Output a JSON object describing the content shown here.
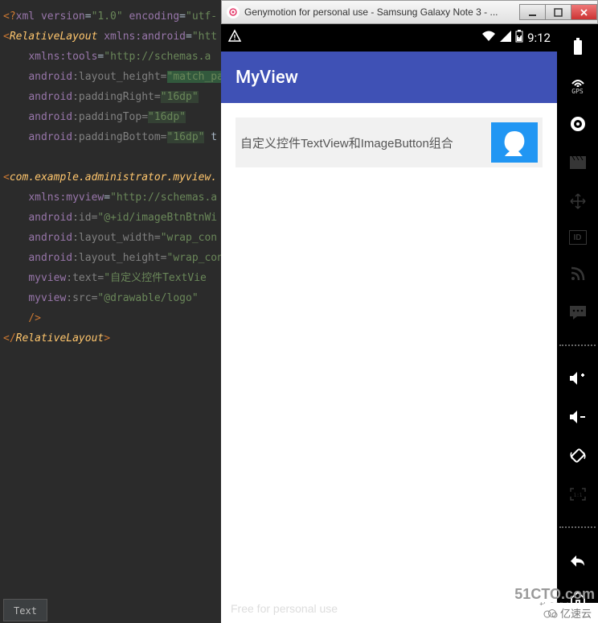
{
  "code": {
    "l1a": "<?",
    "l1b": "xml version",
    "l1c": "=",
    "l1d": "\"1.0\"",
    "l1e": " encoding",
    "l1f": "=",
    "l1g": "\"utf-",
    "l2a": "<",
    "l2b": "RelativeLayout ",
    "l2c": "xmlns:",
    "l2d": "android",
    "l2e": "=",
    "l2f": "\"htt",
    "l3a": "    ",
    "l3b": "xmlns:",
    "l3c": "tools",
    "l3d": "=",
    "l3e": "\"http://schemas.a",
    "l4a": "    ",
    "l4b": "android",
    "l4c": ":layout_height=",
    "l4d": "\"match_pa",
    "l5a": "    ",
    "l5b": "android",
    "l5c": ":paddingRight=",
    "l5d": "\"16dp\"",
    "l6a": "    ",
    "l6b": "android",
    "l6c": ":paddingTop=",
    "l6d": "\"16dp\"",
    "l7a": "    ",
    "l7b": "android",
    "l7c": ":paddingBottom=",
    "l7d": "\"16dp\"",
    "l7e": " t",
    "l8": "",
    "l9a": "<",
    "l9b": "com.example.administrator.myview.",
    "l10a": "    ",
    "l10b": "xmlns:",
    "l10c": "myview",
    "l10d": "=",
    "l10e": "\"http://schemas.a",
    "l11a": "    ",
    "l11b": "android",
    "l11c": ":id=",
    "l11d": "\"@+id/imageBtnBtnWi",
    "l12a": "    ",
    "l12b": "android",
    "l12c": ":layout_width=",
    "l12d": "\"wrap_con",
    "l13a": "    ",
    "l13b": "android",
    "l13c": ":layout_height=",
    "l13d": "\"wrap_con",
    "l14a": "    ",
    "l14b": "myview",
    "l14c": ":text=",
    "l14d": "\"自定义控件TextVie",
    "l15a": "    ",
    "l15b": "myview",
    "l15c": ":src=",
    "l15d": "\"@drawable/logo\"",
    "l16": "    />",
    "l17a": "</",
    "l17b": "RelativeLayout",
    "l17c": ">"
  },
  "tab": "Text",
  "window_title": "Genymotion for personal use - Samsung Galaxy Note 3 - ...",
  "status_time": "9:12",
  "gps_label": "GPS",
  "id_label": "ID",
  "app_title": "MyView",
  "card_text": "自定义控件TextView和ImageButton组合",
  "free_text": "Free for personal use",
  "watermark": "51CTO.com",
  "watermark_sub": "技术博客 · Blog",
  "yisu": "亿速云"
}
